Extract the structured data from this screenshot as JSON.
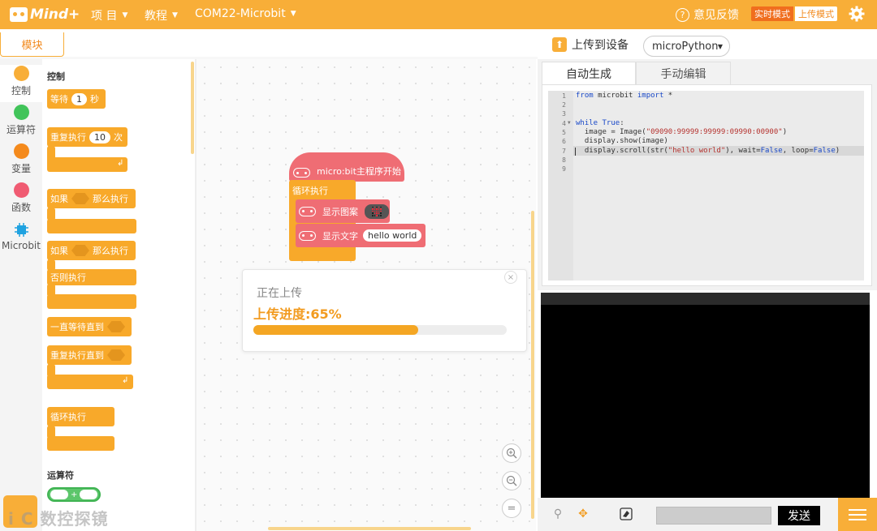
{
  "topbar": {
    "logo_text": "Mind+",
    "menus": [
      {
        "label": "项 目"
      },
      {
        "label": "教程"
      },
      {
        "label": "COM22-Microbit"
      }
    ],
    "feedback": "意见反馈",
    "mode_live": "实时模式",
    "mode_upload": "上传模式"
  },
  "module_tab": "模块",
  "upload": {
    "label": "上传到设备",
    "language": "microPython"
  },
  "categories": [
    {
      "label": "控制",
      "color": "#f8ae38"
    },
    {
      "label": "运算符",
      "color": "#41c45a"
    },
    {
      "label": "变量",
      "color": "#f48a1c"
    },
    {
      "label": "函数",
      "color": "#f05b72"
    },
    {
      "label": "Microbit",
      "color": "#1fa2e0"
    }
  ],
  "palette": {
    "section_control": "控制",
    "wait": {
      "label": "等待",
      "value": "1",
      "unit": "秒"
    },
    "repeat": {
      "label": "重复执行",
      "value": "10",
      "unit": "次"
    },
    "if_then": {
      "pre": "如果",
      "post": "那么执行"
    },
    "if_else": {
      "pre": "如果",
      "post": "那么执行",
      "else": "否则执行"
    },
    "wait_until": "一直等待直到",
    "repeat_until": "重复执行直到",
    "forever": "循环执行",
    "section_operators": "运算符",
    "op_plus": "+"
  },
  "canvas": {
    "hat": "micro:bit主程序开始",
    "forever": "循环执行",
    "show_image": "显示图案",
    "show_text": "显示文字",
    "text_value": "hello world",
    "image_pattern": "09090:99999:99999:09990:00900"
  },
  "dialog": {
    "title": "正在上传",
    "progress_text": "上传进度:65%",
    "progress": 0.65,
    "close": "×"
  },
  "zoom": {
    "in": "+",
    "out": "−",
    "reset": "="
  },
  "code_tabs": {
    "auto": "自动生成",
    "manual": "手动编辑"
  },
  "code": {
    "line_numbers": [
      "1",
      "2",
      "3",
      "4",
      "5",
      "6",
      "7",
      "8",
      "9"
    ],
    "line1_kw1": "from",
    "line1_mid": " microbit ",
    "line1_kw2": "import",
    "line1_end": " *",
    "line4_kw": "while",
    "line4_kw2": "True",
    "line4_end": ":",
    "line5_a": "  image = Image(",
    "line5_str": "\"09090:99999:99999:09990:00900\"",
    "line5_b": ")",
    "line6": "  display.show(image)",
    "line7_a": "  display.scroll(str(",
    "line7_str": "\"hello world\"",
    "line7_b": "), wait=",
    "line7_f1": "False",
    "line7_c": ", loop=",
    "line7_f2": "False",
    "line7_d": ")"
  },
  "serial": {
    "send": "发送"
  },
  "watermark": "i C 数控探镜"
}
